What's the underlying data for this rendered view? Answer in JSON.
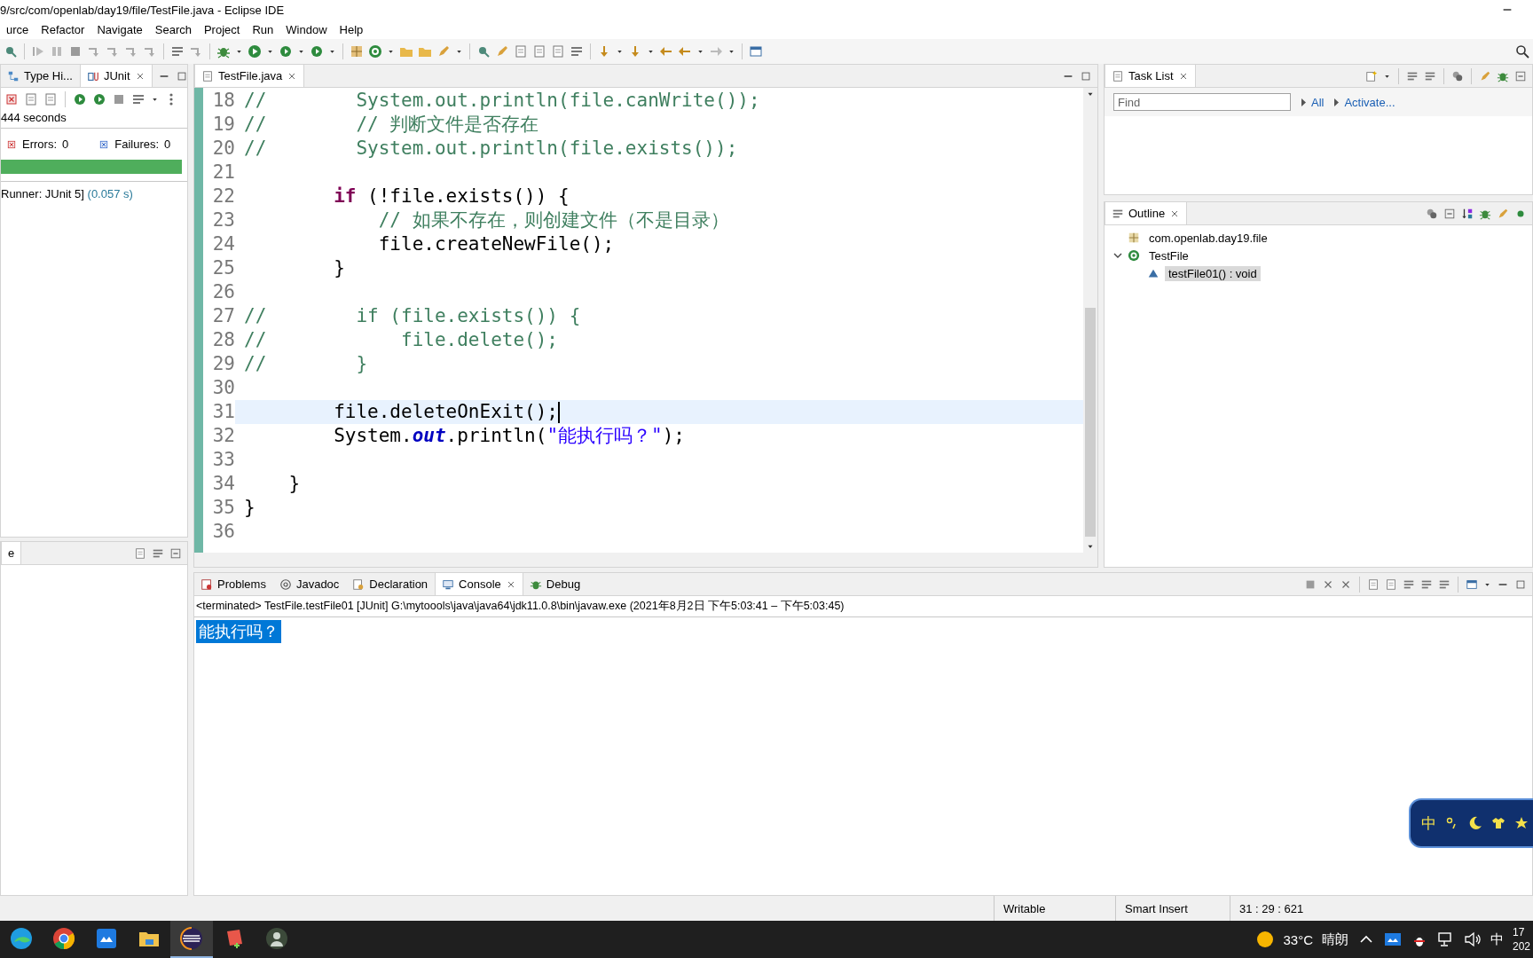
{
  "window": {
    "title": "9/src/com/openlab/day19/file/TestFile.java - Eclipse IDE"
  },
  "menu": [
    {
      "label": "urce"
    },
    {
      "label": "Refactor"
    },
    {
      "label": "Navigate"
    },
    {
      "label": "Search"
    },
    {
      "label": "Project"
    },
    {
      "label": "Run"
    },
    {
      "label": "Window"
    },
    {
      "label": "Help"
    }
  ],
  "junit": {
    "tabs": [
      {
        "label": "Type Hi...",
        "selected": false
      },
      {
        "label": "JUnit",
        "selected": true
      }
    ],
    "elapsed": "444 seconds",
    "errors_label": "Errors:",
    "errors": "0",
    "failures_label": "Failures:",
    "failures": "0",
    "progress": {
      "level": 1
    },
    "runner": "Runner: JUnit 5]",
    "runner_time": "(0.057 s)",
    "bottom_view_title": "e"
  },
  "editor": {
    "tabs": [
      {
        "label": "TestFile.java",
        "selected": true
      }
    ],
    "lines": [
      {
        "number": "18",
        "current": false,
        "segments": [
          {
            "kind": "comment",
            "text": "//        System.out.println(file.canWrite());"
          }
        ]
      },
      {
        "number": "19",
        "current": false,
        "segments": [
          {
            "kind": "comment",
            "text": "//        // 判断文件是否存在"
          }
        ]
      },
      {
        "number": "20",
        "current": false,
        "segments": [
          {
            "kind": "comment",
            "text": "//        System.out.println(file.exists());"
          }
        ]
      },
      {
        "number": "21",
        "current": false
      },
      {
        "number": "22",
        "current": false,
        "segments": [
          {
            "kind": "keyword",
            "text": "        if"
          },
          {
            "kind": "plain",
            "text": " (!file.exists()) {"
          }
        ]
      },
      {
        "number": "23",
        "current": false,
        "segments": [
          {
            "kind": "comment",
            "text": "            // 如果不存在，则创建文件（不是目录）"
          }
        ]
      },
      {
        "number": "24",
        "current": false,
        "segments": [
          {
            "kind": "plain",
            "text": "            file.createNewFile();"
          }
        ]
      },
      {
        "number": "25",
        "current": false,
        "segments": [
          {
            "kind": "plain",
            "text": "        }"
          }
        ]
      },
      {
        "number": "26",
        "current": false
      },
      {
        "number": "27",
        "current": false,
        "segments": [
          {
            "kind": "comment",
            "text": "//        if (file.exists()) {"
          }
        ]
      },
      {
        "number": "28",
        "current": false,
        "segments": [
          {
            "kind": "comment",
            "text": "//            file.delete();"
          }
        ]
      },
      {
        "number": "29",
        "current": false,
        "segments": [
          {
            "kind": "comment",
            "text": "//        }"
          }
        ]
      },
      {
        "number": "30",
        "current": false
      },
      {
        "number": "31",
        "current": true,
        "segments": [
          {
            "kind": "plain",
            "text": "        file.deleteOnExit();"
          }
        ]
      },
      {
        "number": "32",
        "current": false,
        "segments": [
          {
            "kind": "plain",
            "text": "        System."
          },
          {
            "kind": "field",
            "text": "out"
          },
          {
            "kind": "plain",
            "text": ".println("
          },
          {
            "kind": "string",
            "text": "\"能执行吗？\""
          },
          {
            "kind": "plain",
            "text": ");"
          }
        ]
      },
      {
        "number": "33",
        "current": false
      },
      {
        "number": "34",
        "current": false,
        "segments": [
          {
            "kind": "plain",
            "text": "    }"
          }
        ]
      },
      {
        "number": "35",
        "current": false,
        "segments": [
          {
            "kind": "plain",
            "text": "}"
          }
        ]
      },
      {
        "number": "36",
        "current": false
      }
    ]
  },
  "task_list": {
    "title": "Task List",
    "find": {
      "placeholder": "Find"
    },
    "links": [
      "All",
      "Activate..."
    ]
  },
  "outline": {
    "title": "Outline",
    "items": [
      {
        "label": "com.openlab.day19.file",
        "kind": "package",
        "selected": false
      },
      {
        "label": "TestFile",
        "kind": "class",
        "selected": false,
        "expanded": true,
        "children": [
          {
            "label": "testFile01() : void",
            "kind": "method",
            "selected": true
          }
        ]
      }
    ]
  },
  "console": {
    "tabs": [
      {
        "label": "Problems",
        "kind": "problems",
        "selected": false
      },
      {
        "label": "Javadoc",
        "kind": "javadoc",
        "selected": false
      },
      {
        "label": "Declaration",
        "kind": "declaration",
        "selected": false
      },
      {
        "label": "Console",
        "kind": "console",
        "selected": true
      },
      {
        "label": "Debug",
        "kind": "debug",
        "selected": false
      }
    ],
    "header": "<terminated> TestFile.testFile01 [JUnit] G:\\mytoools\\java\\java64\\jdk11.0.8\\bin\\javaw.exe  (2021年8月2日 下午5:03:41 – 下午5:03:45)",
    "output": [
      {
        "text": "能执行吗？",
        "selected": true
      }
    ]
  },
  "status_bar": [
    "Writable",
    "Smart Insert",
    "31 : 29 : 621"
  ],
  "ime_bar": {
    "mode": "中"
  },
  "taskbar": {
    "apps": [
      {
        "kind": "edge",
        "active": false
      },
      {
        "kind": "chrome",
        "active": false
      },
      {
        "kind": "app",
        "active": false
      },
      {
        "kind": "explorer",
        "active": false
      },
      {
        "kind": "eclipse",
        "active": true
      },
      {
        "kind": "notes",
        "active": false
      },
      {
        "kind": "avatar",
        "active": false
      }
    ],
    "temperature": "33°C",
    "weather": "晴朗",
    "input_mode": "中",
    "time": "17",
    "date": "202"
  }
}
